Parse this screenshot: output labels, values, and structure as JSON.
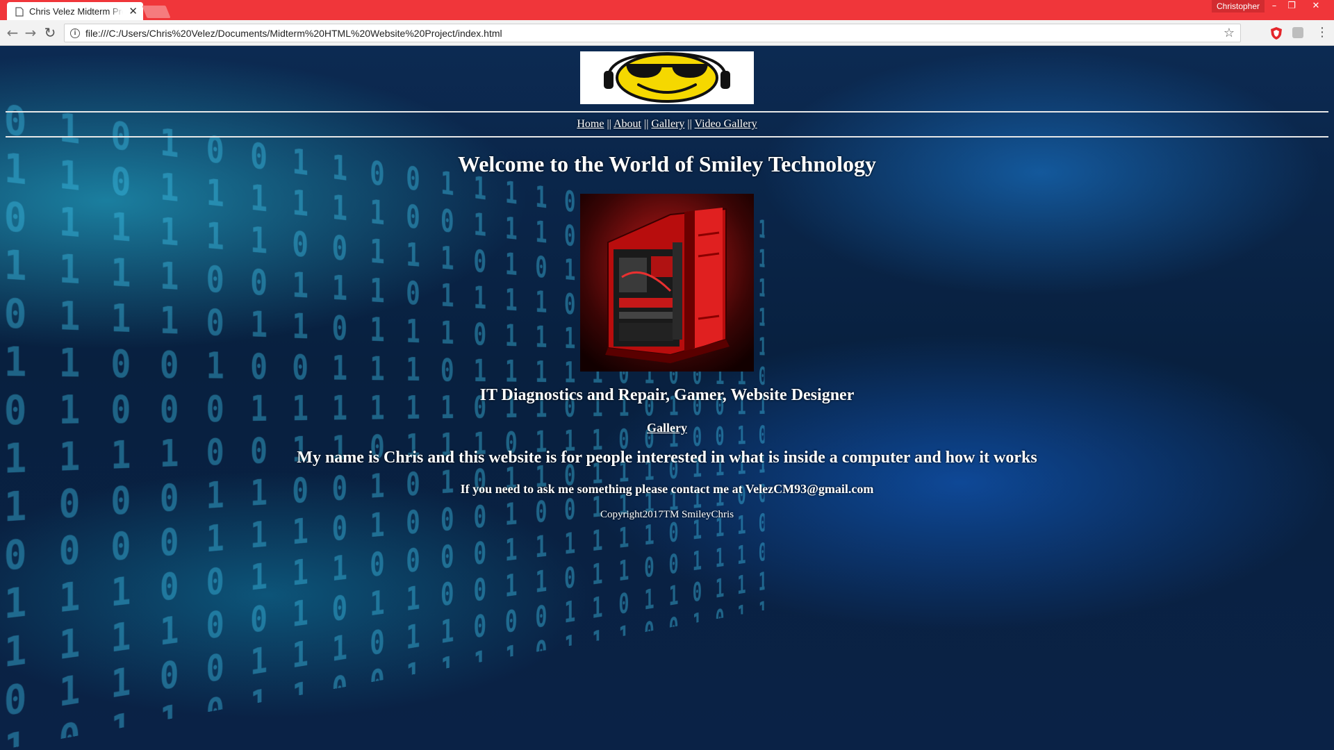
{
  "browser": {
    "tab_title": "Chris Velez Midterm Project",
    "tab_close": "✕",
    "profile_name": "Christopher",
    "url": "file:///C:/Users/Chris%20Velez/Documents/Midterm%20HTML%20Website%20Project/index.html",
    "accent_color": "#f0363a"
  },
  "page": {
    "nav_links": [
      "Home",
      "About",
      "Gallery",
      "Video Gallery"
    ],
    "nav_separator": "||",
    "welcome_heading": "Welcome to the World of Smiley Technology",
    "tagline": "IT Diagnostics and Repair, Gamer, Website Designer",
    "gallery_link": "Gallery",
    "intro": "My name is Chris and this website is for people interested in what is inside a computer and how it works",
    "contact": "If you need to ask me something please contact me at VelezCM93@gmail.com",
    "copyright": "Copyright2017TM SmileyChris"
  }
}
